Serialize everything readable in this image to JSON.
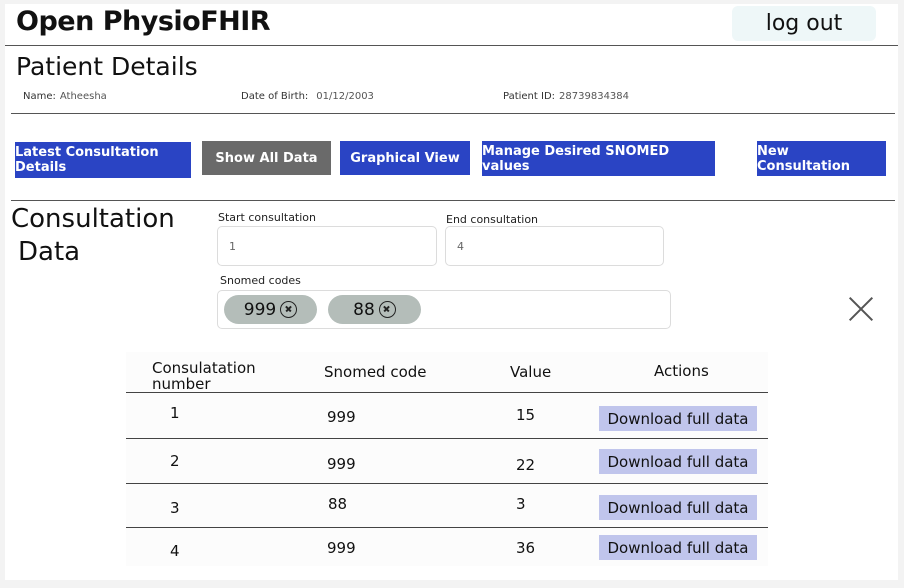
{
  "header": {
    "app_title": "Open PhysioFHIR",
    "logout_label": "log out"
  },
  "patient": {
    "section_title": "Patient Details",
    "name_label": "Name:",
    "name_value": "Atheesha",
    "dob_label": "Date of Birth:",
    "dob_value": "01/12/2003",
    "id_label": "Patient ID:",
    "id_value": "28739834384"
  },
  "toolbar": {
    "latest": "Latest Consultation Details",
    "show_all": "Show All Data",
    "graphical": "Graphical View",
    "manage": "Manage Desired SNOMED values",
    "new": "New Consultation"
  },
  "consultation": {
    "title_line1": "Consultation",
    "title_line2": "Data",
    "start_label": "Start consultation",
    "start_value": "1",
    "end_label": "End consultation",
    "end_value": "4",
    "snomed_label": "Snomed codes",
    "chips": [
      "999",
      "88"
    ]
  },
  "table": {
    "headers": {
      "number": "Consulatation number",
      "code": "Snomed code",
      "value": "Value",
      "actions": "Actions"
    },
    "rows": [
      {
        "number": "1",
        "code": "999",
        "value": "15",
        "action": "Download full data"
      },
      {
        "number": "2",
        "code": "999",
        "value": "22",
        "action": "Download full data"
      },
      {
        "number": "3",
        "code": "88",
        "value": "3",
        "action": "Download full data"
      },
      {
        "number": "4",
        "code": "999",
        "value": "36",
        "action": "Download full data"
      }
    ]
  },
  "colors": {
    "primary_button": "#2a44c4",
    "active_button": "#6a6a6a",
    "download_button": "#c0c5ec",
    "chip": "#b4bdb9"
  }
}
